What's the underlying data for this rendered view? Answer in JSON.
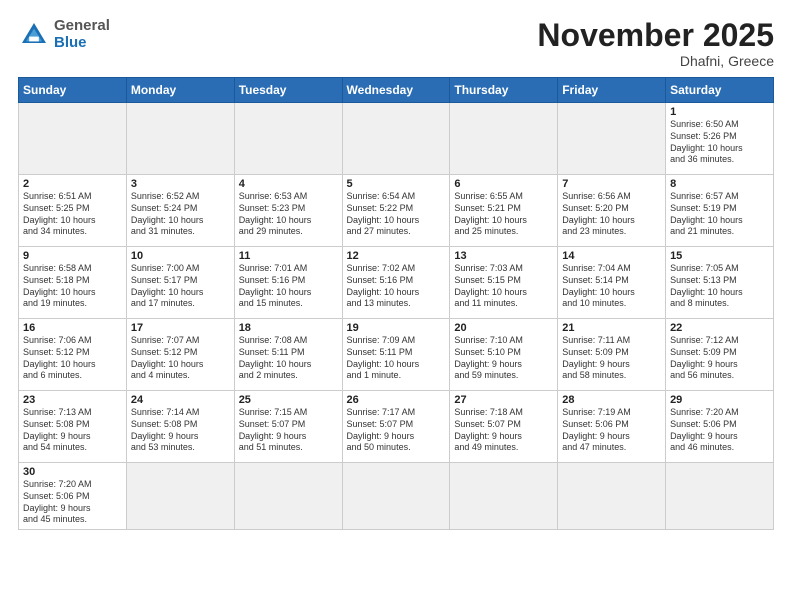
{
  "header": {
    "logo_general": "General",
    "logo_blue": "Blue",
    "month": "November 2025",
    "location": "Dhafni, Greece"
  },
  "weekdays": [
    "Sunday",
    "Monday",
    "Tuesday",
    "Wednesday",
    "Thursday",
    "Friday",
    "Saturday"
  ],
  "weeks": [
    [
      {
        "day": "",
        "info": "",
        "empty": true
      },
      {
        "day": "",
        "info": "",
        "empty": true
      },
      {
        "day": "",
        "info": "",
        "empty": true
      },
      {
        "day": "",
        "info": "",
        "empty": true
      },
      {
        "day": "",
        "info": "",
        "empty": true
      },
      {
        "day": "",
        "info": "",
        "empty": true
      },
      {
        "day": "1",
        "info": "Sunrise: 6:50 AM\nSunset: 5:26 PM\nDaylight: 10 hours\nand 36 minutes."
      }
    ],
    [
      {
        "day": "2",
        "info": "Sunrise: 6:51 AM\nSunset: 5:25 PM\nDaylight: 10 hours\nand 34 minutes."
      },
      {
        "day": "3",
        "info": "Sunrise: 6:52 AM\nSunset: 5:24 PM\nDaylight: 10 hours\nand 31 minutes."
      },
      {
        "day": "4",
        "info": "Sunrise: 6:53 AM\nSunset: 5:23 PM\nDaylight: 10 hours\nand 29 minutes."
      },
      {
        "day": "5",
        "info": "Sunrise: 6:54 AM\nSunset: 5:22 PM\nDaylight: 10 hours\nand 27 minutes."
      },
      {
        "day": "6",
        "info": "Sunrise: 6:55 AM\nSunset: 5:21 PM\nDaylight: 10 hours\nand 25 minutes."
      },
      {
        "day": "7",
        "info": "Sunrise: 6:56 AM\nSunset: 5:20 PM\nDaylight: 10 hours\nand 23 minutes."
      },
      {
        "day": "8",
        "info": "Sunrise: 6:57 AM\nSunset: 5:19 PM\nDaylight: 10 hours\nand 21 minutes."
      }
    ],
    [
      {
        "day": "9",
        "info": "Sunrise: 6:58 AM\nSunset: 5:18 PM\nDaylight: 10 hours\nand 19 minutes."
      },
      {
        "day": "10",
        "info": "Sunrise: 7:00 AM\nSunset: 5:17 PM\nDaylight: 10 hours\nand 17 minutes."
      },
      {
        "day": "11",
        "info": "Sunrise: 7:01 AM\nSunset: 5:16 PM\nDaylight: 10 hours\nand 15 minutes."
      },
      {
        "day": "12",
        "info": "Sunrise: 7:02 AM\nSunset: 5:16 PM\nDaylight: 10 hours\nand 13 minutes."
      },
      {
        "day": "13",
        "info": "Sunrise: 7:03 AM\nSunset: 5:15 PM\nDaylight: 10 hours\nand 11 minutes."
      },
      {
        "day": "14",
        "info": "Sunrise: 7:04 AM\nSunset: 5:14 PM\nDaylight: 10 hours\nand 10 minutes."
      },
      {
        "day": "15",
        "info": "Sunrise: 7:05 AM\nSunset: 5:13 PM\nDaylight: 10 hours\nand 8 minutes."
      }
    ],
    [
      {
        "day": "16",
        "info": "Sunrise: 7:06 AM\nSunset: 5:12 PM\nDaylight: 10 hours\nand 6 minutes."
      },
      {
        "day": "17",
        "info": "Sunrise: 7:07 AM\nSunset: 5:12 PM\nDaylight: 10 hours\nand 4 minutes."
      },
      {
        "day": "18",
        "info": "Sunrise: 7:08 AM\nSunset: 5:11 PM\nDaylight: 10 hours\nand 2 minutes."
      },
      {
        "day": "19",
        "info": "Sunrise: 7:09 AM\nSunset: 5:11 PM\nDaylight: 10 hours\nand 1 minute."
      },
      {
        "day": "20",
        "info": "Sunrise: 7:10 AM\nSunset: 5:10 PM\nDaylight: 9 hours\nand 59 minutes."
      },
      {
        "day": "21",
        "info": "Sunrise: 7:11 AM\nSunset: 5:09 PM\nDaylight: 9 hours\nand 58 minutes."
      },
      {
        "day": "22",
        "info": "Sunrise: 7:12 AM\nSunset: 5:09 PM\nDaylight: 9 hours\nand 56 minutes."
      }
    ],
    [
      {
        "day": "23",
        "info": "Sunrise: 7:13 AM\nSunset: 5:08 PM\nDaylight: 9 hours\nand 54 minutes."
      },
      {
        "day": "24",
        "info": "Sunrise: 7:14 AM\nSunset: 5:08 PM\nDaylight: 9 hours\nand 53 minutes."
      },
      {
        "day": "25",
        "info": "Sunrise: 7:15 AM\nSunset: 5:07 PM\nDaylight: 9 hours\nand 51 minutes."
      },
      {
        "day": "26",
        "info": "Sunrise: 7:17 AM\nSunset: 5:07 PM\nDaylight: 9 hours\nand 50 minutes."
      },
      {
        "day": "27",
        "info": "Sunrise: 7:18 AM\nSunset: 5:07 PM\nDaylight: 9 hours\nand 49 minutes."
      },
      {
        "day": "28",
        "info": "Sunrise: 7:19 AM\nSunset: 5:06 PM\nDaylight: 9 hours\nand 47 minutes."
      },
      {
        "day": "29",
        "info": "Sunrise: 7:20 AM\nSunset: 5:06 PM\nDaylight: 9 hours\nand 46 minutes."
      }
    ],
    [
      {
        "day": "30",
        "info": "Sunrise: 7:20 AM\nSunset: 5:06 PM\nDaylight: 9 hours\nand 45 minutes."
      },
      {
        "day": "",
        "info": "",
        "empty": true
      },
      {
        "day": "",
        "info": "",
        "empty": true
      },
      {
        "day": "",
        "info": "",
        "empty": true
      },
      {
        "day": "",
        "info": "",
        "empty": true
      },
      {
        "day": "",
        "info": "",
        "empty": true
      },
      {
        "day": "",
        "info": "",
        "empty": true
      }
    ]
  ]
}
